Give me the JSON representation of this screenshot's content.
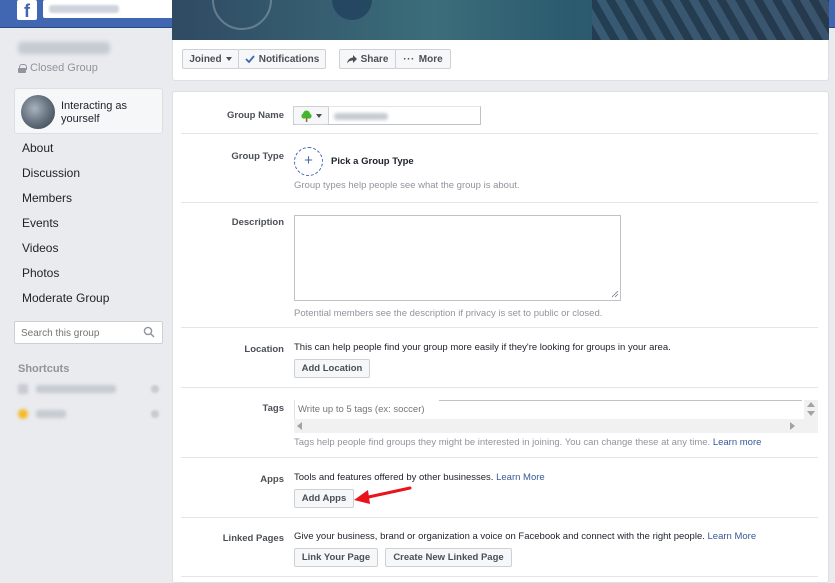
{
  "topbar": {
    "logo": "f"
  },
  "group": {
    "privacy": "Closed Group"
  },
  "identity": {
    "text": "Interacting as yourself"
  },
  "nav": {
    "items": [
      {
        "label": "About"
      },
      {
        "label": "Discussion"
      },
      {
        "label": "Members"
      },
      {
        "label": "Events"
      },
      {
        "label": "Videos"
      },
      {
        "label": "Photos"
      },
      {
        "label": "Moderate Group"
      }
    ]
  },
  "side_search": {
    "placeholder": "Search this group"
  },
  "shortcuts": {
    "label": "Shortcuts"
  },
  "actions": {
    "joined": "Joined",
    "notifications": "Notifications",
    "share": "Share",
    "more": "More"
  },
  "settings": {
    "group_name": {
      "label": "Group Name"
    },
    "group_type": {
      "label": "Group Type",
      "pick": "Pick a Group Type",
      "help": "Group types help people see what the group is about."
    },
    "description": {
      "label": "Description",
      "help": "Potential members see the description if privacy is set to public or closed."
    },
    "location": {
      "label": "Location",
      "text": "This can help people find your group more easily if they're looking for groups in your area.",
      "button": "Add Location"
    },
    "tags": {
      "label": "Tags",
      "placeholder": "Write up to 5 tags (ex: soccer)",
      "help": "Tags help people find groups they might be interested in joining. You can change these at any time.",
      "learn_more": "Learn more"
    },
    "apps": {
      "label": "Apps",
      "text": "Tools and features offered by other businesses.",
      "learn_more": "Learn More",
      "button": "Add Apps"
    },
    "linked_pages": {
      "label": "Linked Pages",
      "text": "Give your business, brand or organization a voice on Facebook and connect with the right people.",
      "learn_more": "Learn More",
      "link_button": "Link Your Page",
      "create_button": "Create New Linked Page"
    }
  },
  "colors": {
    "brand_blue": "#4267b2",
    "link_blue": "#365899",
    "annotation_red": "#e8141b"
  }
}
